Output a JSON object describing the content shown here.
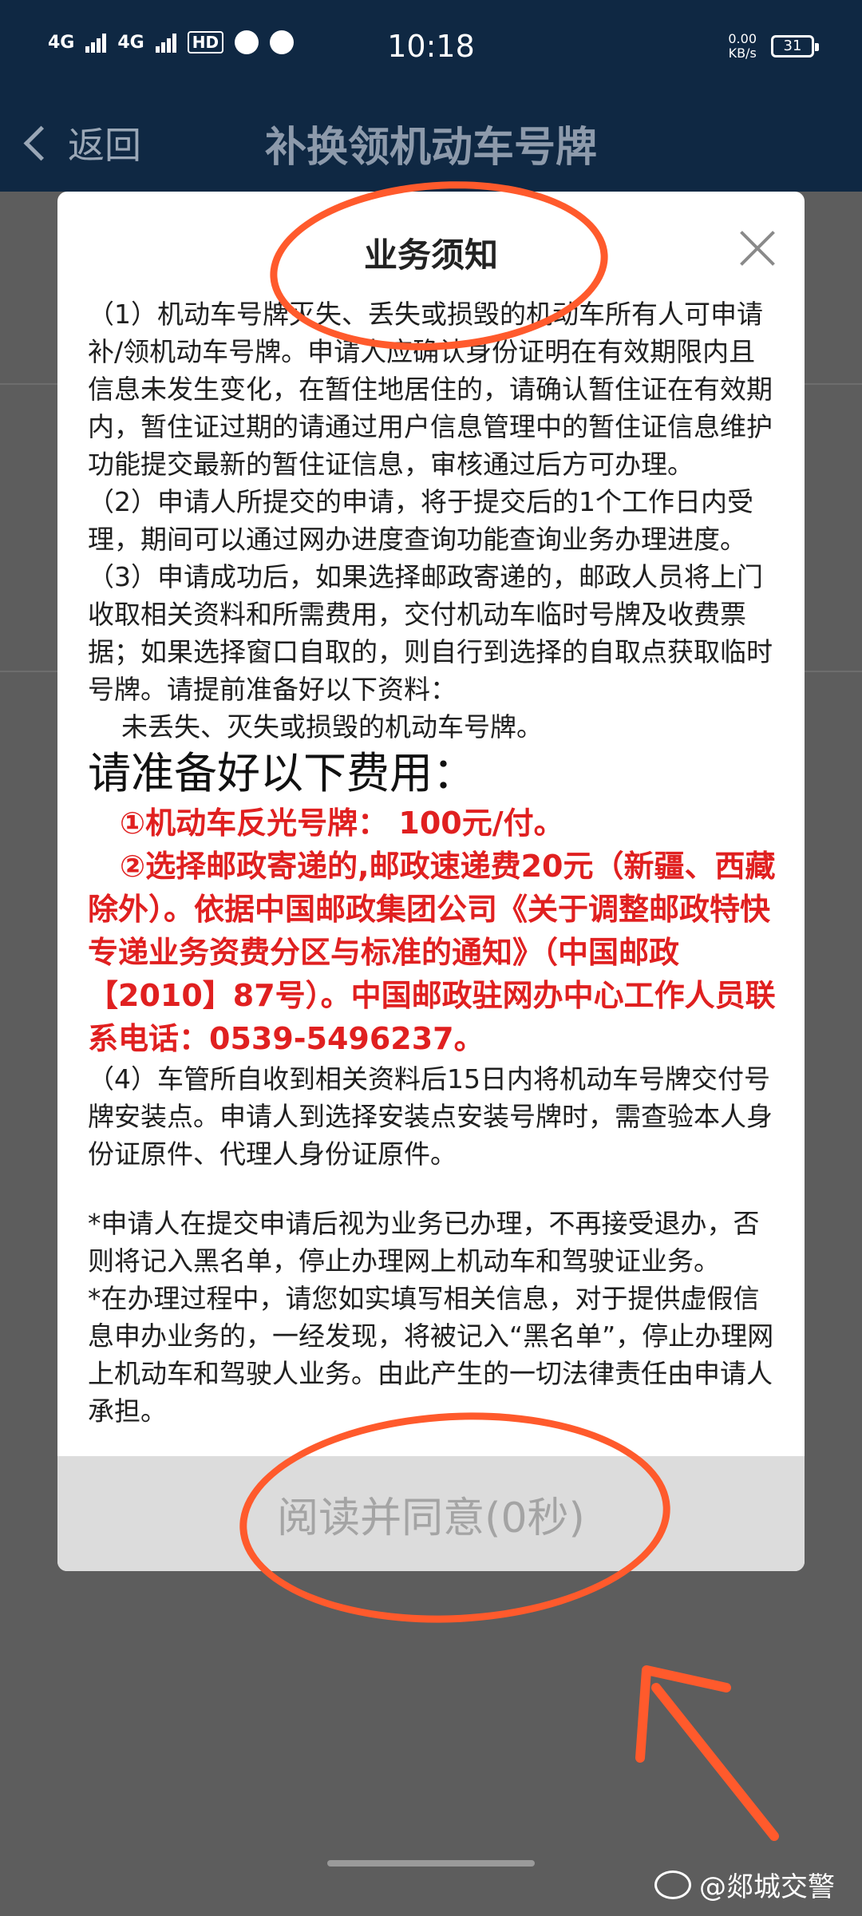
{
  "statusbar": {
    "network1": "4G",
    "network2": "4G",
    "hd": "HD",
    "time": "10:18",
    "speed": "0.00",
    "speed_unit": "KB/s",
    "battery": "31"
  },
  "header": {
    "back_label": "返回",
    "title": "补换领机动车号牌"
  },
  "modal": {
    "title": "业务须知",
    "paragraphs": {
      "p1": "（1）机动车号牌灭失、丢失或损毁的机动车所有人可申请补/领机动车号牌。申请人应确认身份证明在有效期限内且信息未发生变化，在暂住地居住的，请确认暂住证在有效期内，暂住证过期的请通过用户信息管理中的暂住证信息维护功能提交最新的暂住证信息，审核通过后方可办理。",
      "p2": "（2）申请人所提交的申请，将于提交后的1个工作日内受理，期间可以通过网办进度查询功能查询业务办理进度。",
      "p3": "（3）申请成功后，如果选择邮政寄递的，邮政人员将上门收取相关资料和所需费用，交付机动车临时号牌及收费票据；如果选择窗口自取的，则自行到选择的自取点获取临时号牌。请提前准备好以下资料：",
      "p3_item": "未丢失、灭失或损毁的机动车号牌。",
      "fee_title": "请准备好以下费用：",
      "fee1": "①机动车反光号牌： 100元/付。",
      "fee2": "②选择邮政寄递的,邮政速递费20元（新疆、西藏除外）。依据中国邮政集团公司《关于调整邮政特快专递业务资费分区与标准的通知》（中国邮政【2010】87号）。中国邮政驻网办中心工作人员联系电话：0539-5496237。",
      "p4": "（4）车管所自收到相关资料后15日内将机动车号牌交付号牌安装点。申请人到选择安装点安装号牌时，需查验本人身份证原件、代理人身份证原件。",
      "note1": "*申请人在提交申请后视为业务已办理，不再接受退办，否则将记入黑名单，停止办理网上机动车和驾驶证业务。",
      "note2": "*在办理过程中，请您如实填写相关信息，对于提供虚假信息申办业务的，一经发现，将被记入“黑名单”，停止办理网上机动车和驾驶人业务。由此产生的一切法律责任由申请人承担。"
    },
    "agree_button": "阅读并同意(0秒)"
  },
  "watermark": "@郯城交警",
  "colors": {
    "header_bg": "#0f2843",
    "highlight_red": "#e02020",
    "annotation_orange": "#ff5a2c",
    "agree_disabled_bg": "#dcdcdc"
  }
}
